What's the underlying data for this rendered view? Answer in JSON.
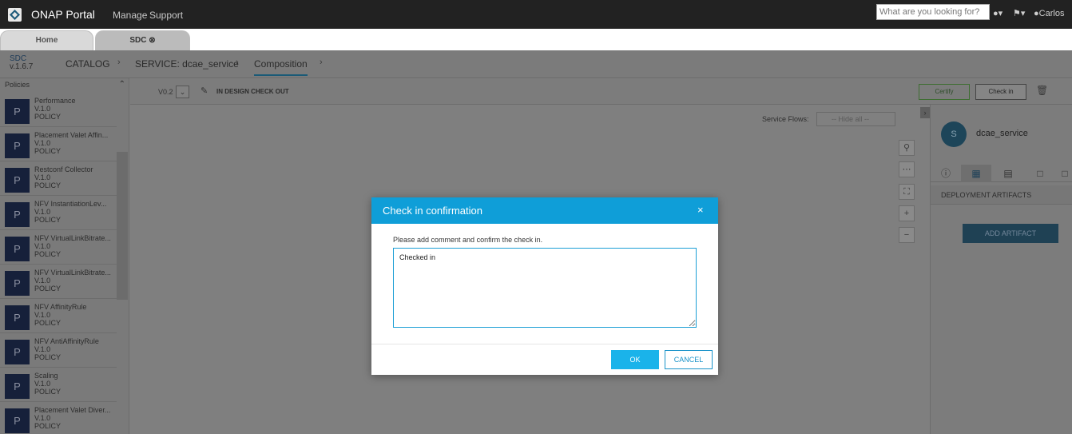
{
  "portal": {
    "title": "ONAP Portal",
    "nav": [
      "Manage",
      "Support"
    ],
    "search_placeholder": "What are you looking for?",
    "user": "Carlos",
    "icons": [
      "lightbulb-icon",
      "flag-icon",
      "user-icon"
    ]
  },
  "tabs": [
    {
      "label": "Home"
    },
    {
      "label": "SDC"
    }
  ],
  "breadcrumb": {
    "app": "SDC",
    "version": "v.1.6.7",
    "items": [
      "CATALOG",
      "SERVICE: dcae_service",
      "Composition"
    ]
  },
  "palette": {
    "header": "Policies",
    "items": [
      {
        "icon_letter": "P",
        "name": "Performance",
        "version": "V.1.0",
        "type": "POLICY"
      },
      {
        "icon_letter": "P",
        "name": "Placement Valet Affin...",
        "version": "V.1.0",
        "type": "POLICY"
      },
      {
        "icon_letter": "P",
        "name": "Restconf Collector",
        "version": "V.1.0",
        "type": "POLICY"
      },
      {
        "icon_letter": "P",
        "name": "NFV InstantiationLev...",
        "version": "V.1.0",
        "type": "POLICY"
      },
      {
        "icon_letter": "P",
        "name": "NFV VirtualLinkBitrate...",
        "version": "V.1.0",
        "type": "POLICY"
      },
      {
        "icon_letter": "P",
        "name": "NFV VirtualLinkBitrate...",
        "version": "V.1.0",
        "type": "POLICY"
      },
      {
        "icon_letter": "P",
        "name": "NFV AffinityRule",
        "version": "V.1.0",
        "type": "POLICY"
      },
      {
        "icon_letter": "P",
        "name": "NFV AntiAffinityRule",
        "version": "V.1.0",
        "type": "POLICY"
      },
      {
        "icon_letter": "P",
        "name": "Scaling",
        "version": "V.1.0",
        "type": "POLICY"
      },
      {
        "icon_letter": "P",
        "name": "Placement Valet Diver...",
        "version": "V.1.0",
        "type": "POLICY"
      }
    ]
  },
  "toolbar": {
    "version": "V0.2",
    "status": "IN DESIGN CHECK OUT",
    "certify_label": "Certify",
    "checkin_label": "Check in"
  },
  "canvas": {
    "service_flows_label": "Service Flows:",
    "service_flows_value": "-- Hide all --"
  },
  "right_panel": {
    "avatar_letter": "S",
    "service_name": "dcae_service",
    "section": "DEPLOYMENT ARTIFACTS",
    "add_artifact_label": "ADD ARTIFACT"
  },
  "modal": {
    "title": "Check in confirmation",
    "close": "×",
    "message": "Please add comment and confirm the check in.",
    "comment_value": "Checked in",
    "ok_label": "OK",
    "cancel_label": "CANCEL"
  },
  "colors": {
    "accent": "#0f9ed8",
    "ok_button": "#1ab3ea",
    "portal_bar": "#222222"
  }
}
